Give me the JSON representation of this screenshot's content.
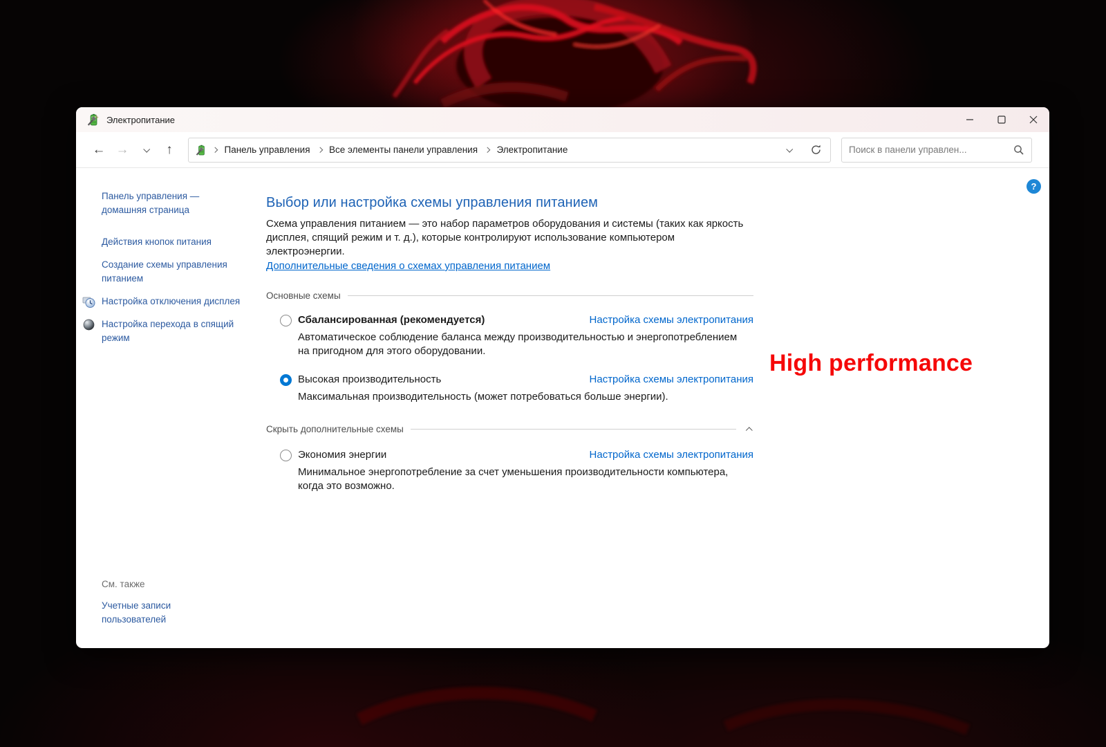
{
  "window": {
    "title": "Электропитание"
  },
  "toolbar": {
    "breadcrumb": [
      "Панель управления",
      "Все элементы панели управления",
      "Электропитание"
    ],
    "search_placeholder": "Поиск в панели управлен..."
  },
  "help": {
    "glyph": "?"
  },
  "sidebar": {
    "items": [
      {
        "label": "Панель управления — домашняя страница",
        "icon": "none"
      },
      {
        "label": "Действия кнопок питания",
        "icon": "none"
      },
      {
        "label": "Создание схемы управления питанием",
        "icon": "none"
      },
      {
        "label": "Настройка отключения дисплея",
        "icon": "display-clock-icon"
      },
      {
        "label": "Настройка перехода в спящий режим",
        "icon": "sleep-icon"
      }
    ],
    "see_also_label": "См. также",
    "see_also_link": "Учетные записи пользователей"
  },
  "main": {
    "heading": "Выбор или настройка схемы управления питанием",
    "description": "Схема управления питанием — это набор параметров оборудования и системы (таких как яркость дисплея, спящий режим и т. д.), которые контролируют использование компьютером электроэнергии.",
    "more_info_link": "Дополнительные сведения о схемах управления питанием",
    "group1_label": "Основные схемы",
    "group2_label": "Скрыть дополнительные схемы",
    "plans": [
      {
        "name": "Сбалансированная (рекомендуется)",
        "bold": true,
        "selected": false,
        "desc": "Автоматическое соблюдение баланса между производительностью и энергопотреблением на пригодном для этого оборудовании.",
        "link": "Настройка схемы электропитания"
      },
      {
        "name": "Высокая производительность",
        "bold": false,
        "selected": true,
        "desc": "Максимальная производительность (может потребоваться больше энергии).",
        "link": "Настройка схемы электропитания"
      },
      {
        "name": "Экономия энергии",
        "bold": false,
        "selected": false,
        "desc": "Минимальное энергопотребление за счет уменьшения производительности компьютера, когда это возможно.",
        "link": "Настройка схемы электропитания"
      }
    ]
  },
  "annotation": {
    "text": "High performance",
    "color": "#f50808"
  },
  "colors": {
    "accent": "#0078d4",
    "heading_blue": "#1d62b5",
    "link_blue": "#0066cc",
    "sidebar_blue": "#2c5aa0",
    "annotation_red": "#f50808",
    "art_red": "#d80f1c"
  }
}
